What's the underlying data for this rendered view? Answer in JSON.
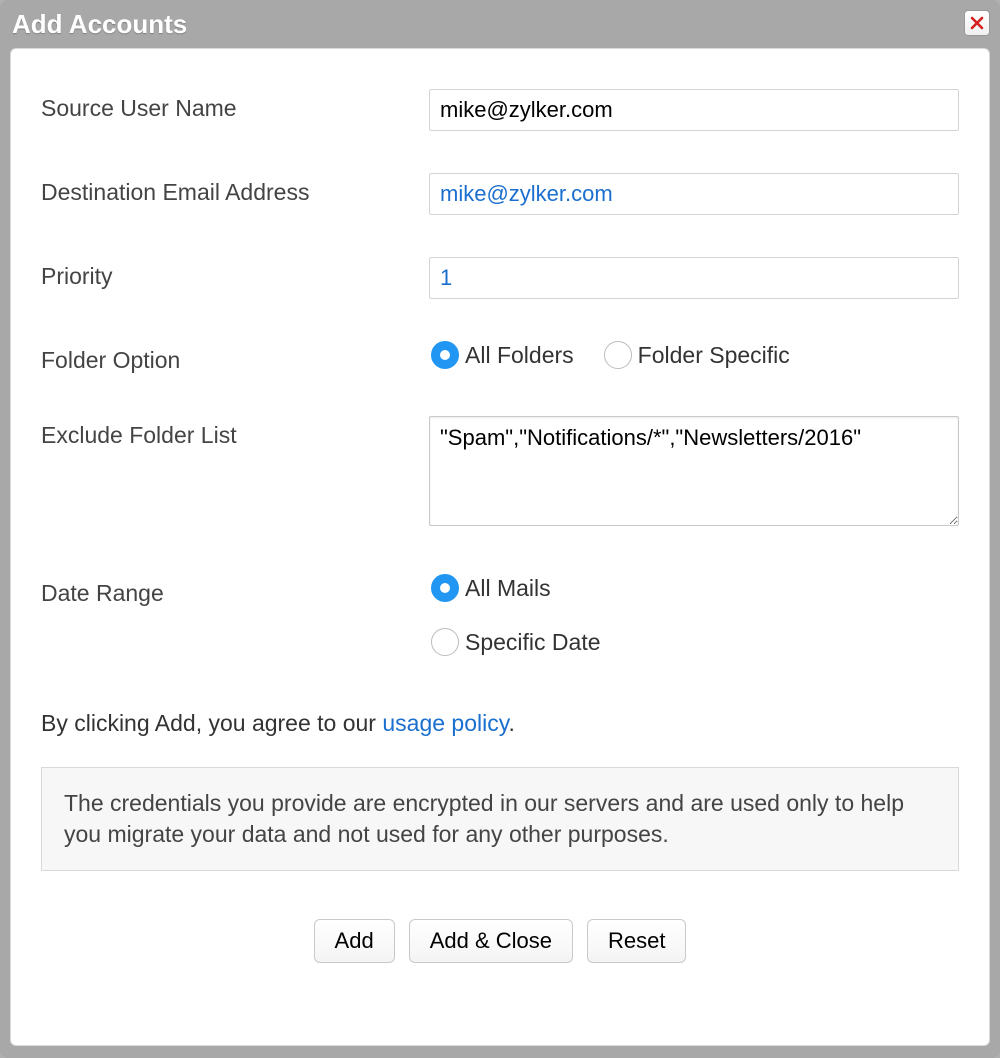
{
  "dialog": {
    "title": "Add Accounts"
  },
  "form": {
    "source_user_name": {
      "label": "Source User Name",
      "value": "mike@zylker.com"
    },
    "destination_email": {
      "label": "Destination Email Address",
      "value": "mike@zylker.com"
    },
    "priority": {
      "label": "Priority",
      "value": "1"
    },
    "folder_option": {
      "label": "Folder Option",
      "options": {
        "all": "All Folders",
        "specific": "Folder Specific"
      },
      "selected": "all"
    },
    "exclude_folder_list": {
      "label": "Exclude Folder List",
      "value": "\"Spam\",\"Notifications/*\",\"Newsletters/2016\""
    },
    "date_range": {
      "label": "Date Range",
      "options": {
        "all": "All Mails",
        "specific": "Specific Date"
      },
      "selected": "all"
    }
  },
  "policy": {
    "prefix": "By clicking Add, you agree to our ",
    "link": "usage policy",
    "suffix": "."
  },
  "notice": "The credentials you provide are encrypted in our servers and are used only to help you migrate your data and not used for any other purposes.",
  "buttons": {
    "add": "Add",
    "add_close": "Add & Close",
    "reset": "Reset"
  }
}
